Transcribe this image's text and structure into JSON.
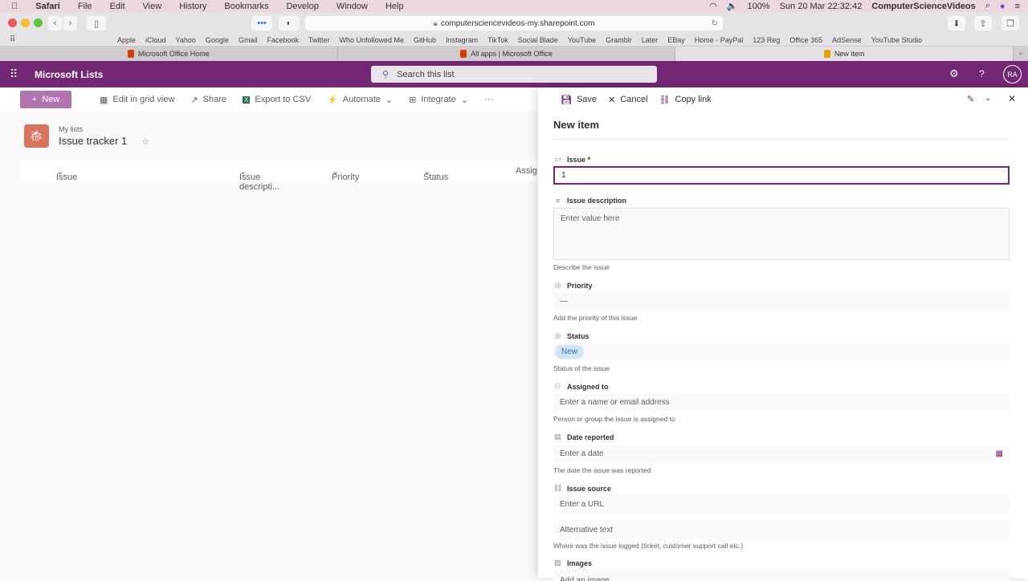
{
  "macos": {
    "menu": [
      "Safari",
      "File",
      "Edit",
      "View",
      "History",
      "Bookmarks",
      "Develop",
      "Window",
      "Help"
    ],
    "battery": "100%",
    "clock": "Sun 20 Mar  22:32:42",
    "user": "ComputerScienceVideos"
  },
  "browser": {
    "url": "computersciencevideos-my.sharepoint.com",
    "bookmarks": [
      "Apple",
      "iCloud",
      "Yahoo",
      "Google",
      "Gmail",
      "Facebook",
      "Twitter",
      "Who Unfollowed Me",
      "GitHub",
      "Instagram",
      "TikTok",
      "Social Blade",
      "YouTube",
      "Gramblr",
      "Later",
      "EBay",
      "Home - PayPal",
      "123 Reg",
      "Office 365",
      "AdSense",
      "YouTube Studio"
    ],
    "tabs": [
      {
        "title": "Microsoft Office Home"
      },
      {
        "title": "All apps | Microsoft Office"
      },
      {
        "title": "New item"
      }
    ]
  },
  "app": {
    "title": "Microsoft Lists",
    "search_placeholder": "Search this list",
    "user_initials": "RA"
  },
  "commands": {
    "new": "New",
    "grid": "Edit in grid view",
    "share": "Share",
    "export": "Export to CSV",
    "automate": "Automate",
    "integrate": "Integrate",
    "more": "···"
  },
  "list": {
    "breadcrumb": "My lists",
    "title": "Issue tracker 1",
    "columns": [
      "Issue",
      "Issue descripti...",
      "Priority",
      "Status",
      "Assig"
    ]
  },
  "panel": {
    "save": "Save",
    "cancel": "Cancel",
    "copy_link": "Copy link",
    "title": "New item",
    "fields": {
      "issue": {
        "label": "Issue *",
        "value": "1"
      },
      "description": {
        "label": "Issue description",
        "placeholder": "Enter value here",
        "help": "Describe the issue"
      },
      "priority": {
        "label": "Priority",
        "value": "—",
        "help": "Add the priority of this issue"
      },
      "status": {
        "label": "Status",
        "value": "New",
        "help": "Status of the issue"
      },
      "assigned": {
        "label": "Assigned to",
        "placeholder": "Enter a name or email address",
        "help": "Person or group the issue is assigned to"
      },
      "date": {
        "label": "Date reported",
        "placeholder": "Enter a date",
        "help": "The date the issue was reported"
      },
      "source": {
        "label": "Issue source",
        "url_placeholder": "Enter a URL",
        "alt_placeholder": "Alternative text",
        "help": "Where was the issue logged (ticket, customer support call etc.)"
      },
      "images": {
        "label": "Images",
        "placeholder": "Add an image"
      }
    }
  },
  "colors": {
    "brand": "#742774",
    "new_button": "#b373b0",
    "status_badge": "#cfe4f7"
  }
}
